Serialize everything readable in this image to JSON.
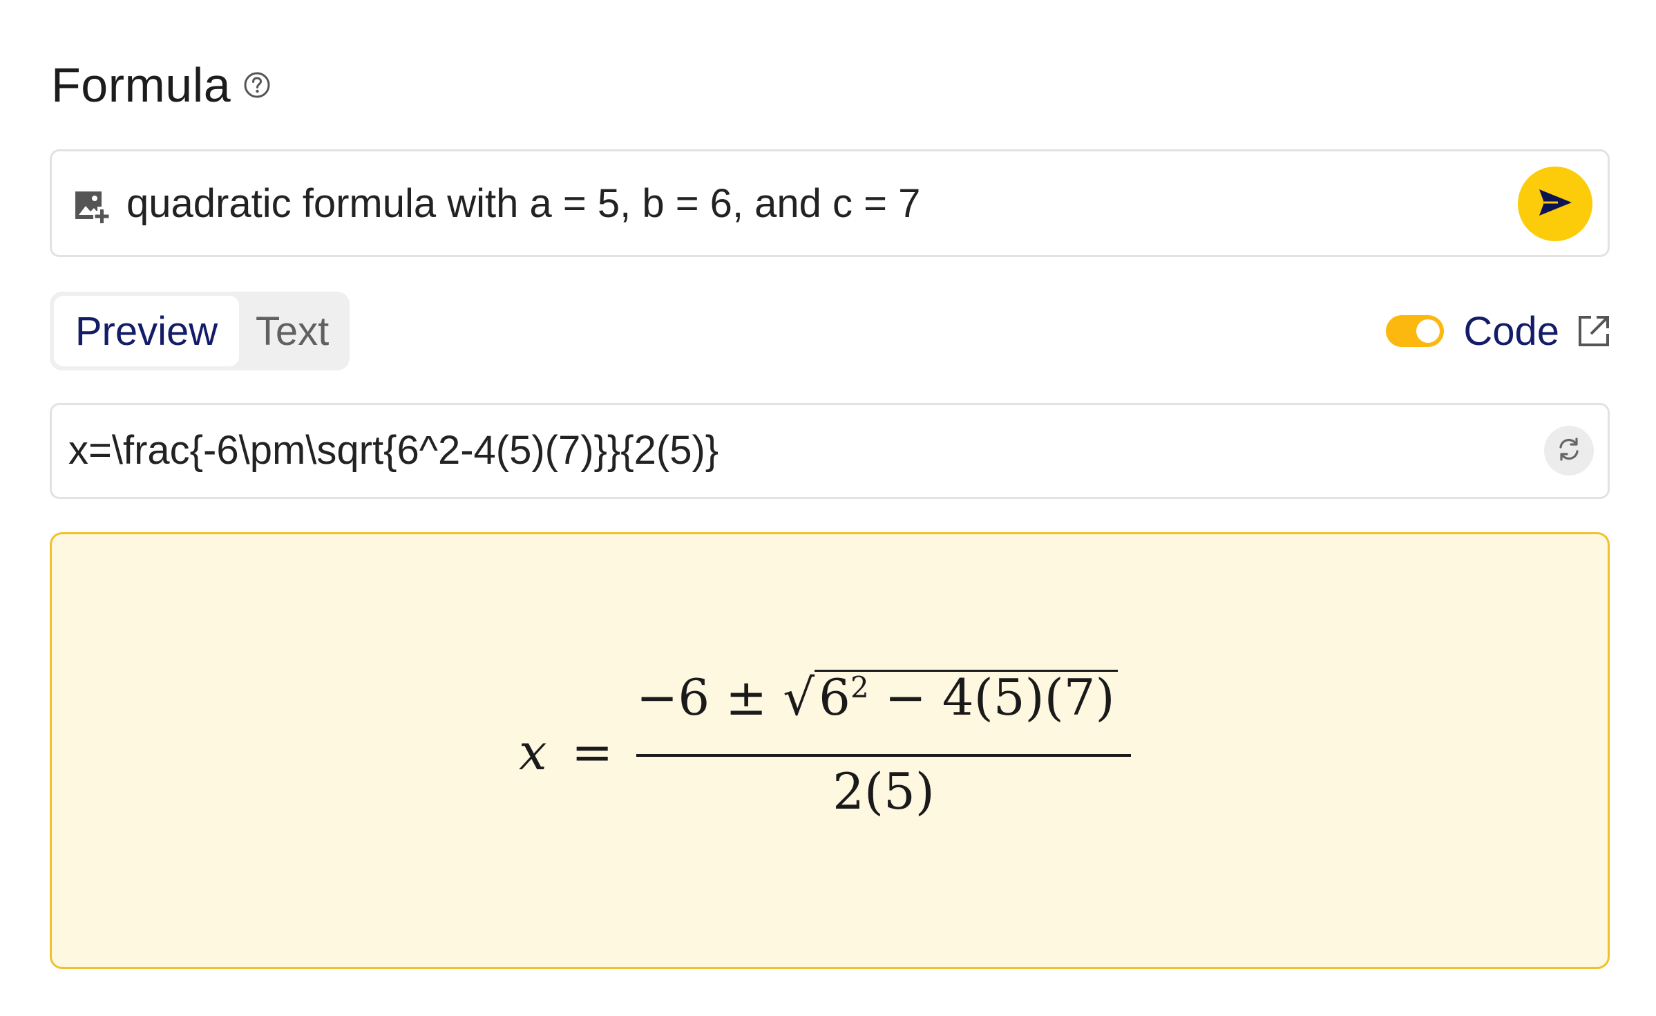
{
  "header": {
    "title": "Formula",
    "help_icon": "question-circle-icon"
  },
  "prompt": {
    "icon": "add-image-icon",
    "value": "quadratic formula with a = 5, b = 6, and c = 7",
    "send_icon": "send-arrow-icon",
    "send_color": "#fccc0a"
  },
  "tabs": [
    {
      "label": "Preview",
      "active": true
    },
    {
      "label": "Text",
      "active": false
    }
  ],
  "code_toggle": {
    "enabled": true,
    "label": "Code",
    "icon": "external-link-icon",
    "toggle_color": "#fcb80e"
  },
  "latex": {
    "value": "x=\\frac{-6\\pm\\sqrt{6^2-4(5)(7)}}{2(5)}",
    "refresh_icon": "refresh-icon"
  },
  "preview": {
    "background": "#fef8e1",
    "border": "#efc12c",
    "rendered": {
      "lhs": "x",
      "equals": "=",
      "numerator_prefix": "−6 ± ",
      "radical": "√",
      "radicand_base": "6",
      "radicand_exponent": "2",
      "radicand_rest": " − 4(5)(7)",
      "denominator": "2(5)"
    }
  },
  "colors": {
    "accent_text": "#131c68",
    "accent_yellow": "#fccc0a"
  }
}
